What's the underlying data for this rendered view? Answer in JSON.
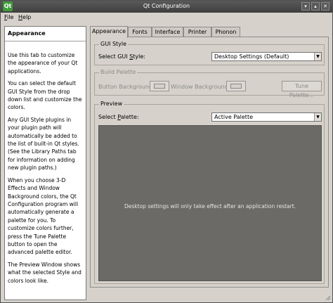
{
  "window": {
    "app_icon": "Qt",
    "title": "Qt Configuration",
    "buttons": [
      "▾",
      "▴",
      "✕"
    ]
  },
  "menubar": {
    "items": [
      {
        "mnemonic": "F",
        "rest": "ile"
      },
      {
        "mnemonic": "H",
        "rest": "elp"
      }
    ]
  },
  "help": {
    "title": "Appearance",
    "paragraphs": [
      "Use this tab to customize the appearance of your Qt applications.",
      "You can select the default GUI Style from the drop down list and customize the colors.",
      "Any GUI Style plugins in your plugin path will automatically be added to the list of built-in Qt styles. (See the Library Paths tab for information on adding new plugin paths.)",
      "When you choose 3-D Effects and Window Background colors, the Qt Configuration program will automatically generate a palette for you. To customize colors further, press the Tune Palette button to open the advanced palette editor.",
      "The Preview Window shows what the selected Style and colors look like."
    ]
  },
  "tabs": [
    "Appearance",
    "Fonts",
    "Interface",
    "Printer",
    "Phonon"
  ],
  "gui_style": {
    "group_title": "GUI Style",
    "label_before": "Select GUI ",
    "label_mnemonic": "S",
    "label_after": "tyle:",
    "value": "Desktop Settings (Default)"
  },
  "build_palette": {
    "group_title": "Build Palette",
    "button_bg_label": "Button Background:",
    "window_bg_label": "Window Background:",
    "tune_button": "Tune Palette..."
  },
  "preview": {
    "group_title": "Preview",
    "label_before": "Select ",
    "label_mnemonic": "P",
    "label_after": "alette:",
    "value": "Active Palette",
    "message": "Desktop settings will only take effect after an application restart."
  }
}
